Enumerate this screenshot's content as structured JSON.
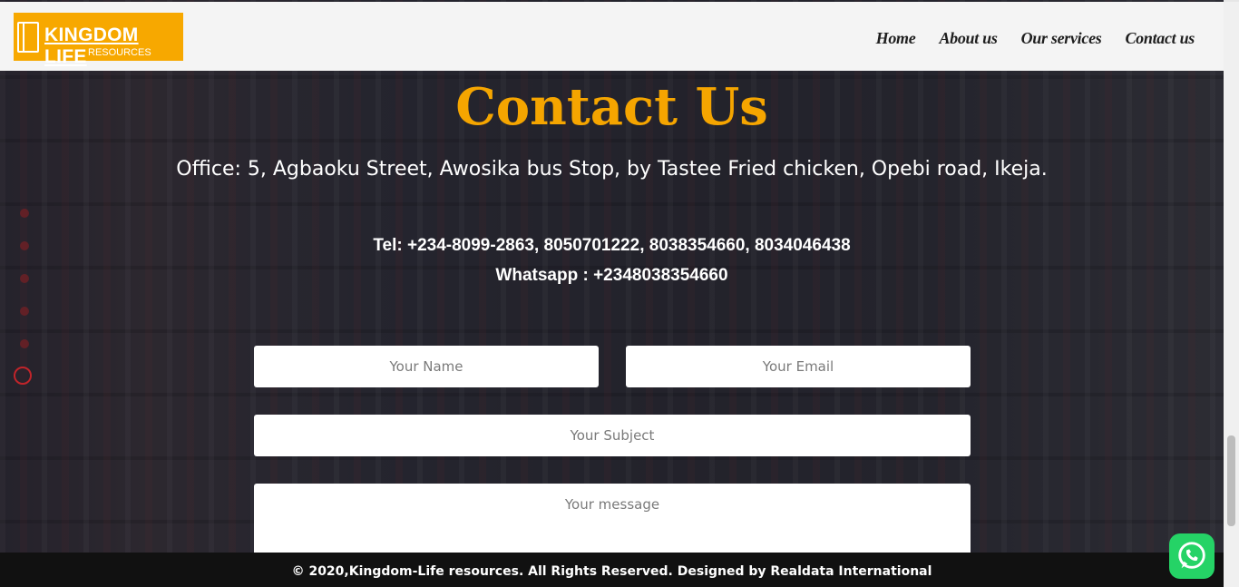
{
  "brand": {
    "name": "KINGDOM LIFE",
    "sub": "RESOURCES",
    "color": "#f7a800"
  },
  "nav": {
    "items": [
      "Home",
      "About us",
      "Our services",
      "Contact us"
    ]
  },
  "contact": {
    "title": "Contact Us",
    "address": "Office: 5, Agbaoku Street, Awosika bus Stop, by Tastee Fried chicken, Opebi road, Ikeja.",
    "tel": "Tel: +234-8099-2863, 8050701222, 8038354660, 8034046438",
    "whatsapp": "Whatsapp : +2348038354660",
    "accent": "#f5a500"
  },
  "form": {
    "name_placeholder": "Your Name",
    "email_placeholder": "Your Email",
    "subject_placeholder": "Your Subject",
    "message_placeholder": "Your message"
  },
  "footer": {
    "text": "© 2020,Kingdom-Life resources. All Rights Reserved. Designed by Realdata International"
  },
  "widgets": {
    "whatsapp_icon": "whatsapp-icon",
    "whatsapp_color": "#25d366"
  }
}
